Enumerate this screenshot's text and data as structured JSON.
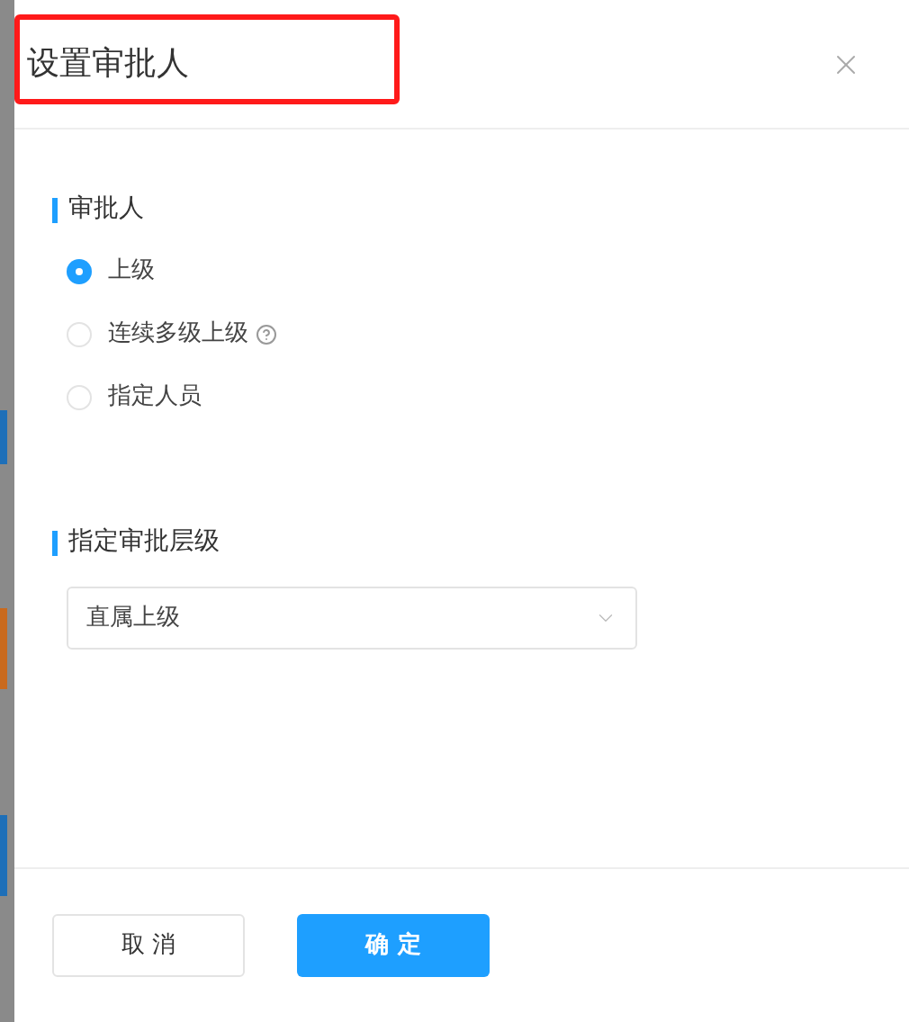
{
  "dialog": {
    "title": "设置审批人",
    "title_highlighted": true
  },
  "sections": [
    {
      "heading": "审批人",
      "kind": "radio",
      "options": [
        {
          "label": "上级",
          "selected": true,
          "help": false
        },
        {
          "label": "连续多级上级",
          "selected": false,
          "help": true
        },
        {
          "label": "指定人员",
          "selected": false,
          "help": false
        }
      ]
    },
    {
      "heading": "指定审批层级",
      "kind": "select",
      "value": "直属上级"
    }
  ],
  "buttons": [
    {
      "label": "取 消",
      "kind": "secondary"
    },
    {
      "label": "确 定",
      "kind": "primary"
    }
  ]
}
